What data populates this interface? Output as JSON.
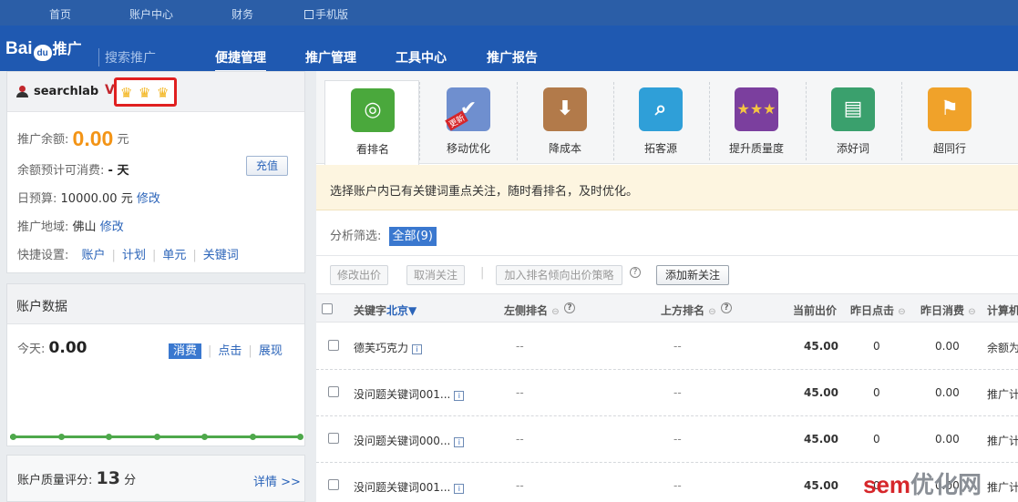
{
  "topnav": {
    "home": "首页",
    "account_center": "账户中心",
    "finance": "财务",
    "mobile": "手机版"
  },
  "header": {
    "logo": "Bai",
    "logo_paw": "du",
    "logo_tail": "推广",
    "sub": "搜索推广",
    "nav": [
      "便捷管理",
      "推广管理",
      "工具中心",
      "推广报告"
    ],
    "active_nav": "便捷管理"
  },
  "account": {
    "username": "searchlab",
    "v_mark": "V",
    "balance_label": "推广余额:",
    "balance_value": "0.00",
    "balance_unit": "元",
    "days_label": "余额预计可消费:",
    "days_value": "- 天",
    "recharge": "充值",
    "budget_label": "日预算:",
    "budget_value": "10000.00 元",
    "budget_edit": "修改",
    "region_label": "推广地域:",
    "region_value": "佛山",
    "region_edit": "修改",
    "quick_label": "快捷设置:",
    "quick": [
      "账户",
      "计划",
      "单元",
      "关键词"
    ]
  },
  "data": {
    "title": "账户数据",
    "today_label": "今天:",
    "today_value": "0.00",
    "tabs": [
      "消费",
      "点击",
      "展现"
    ]
  },
  "quality": {
    "label": "账户质量评分:",
    "score": "13",
    "unit": "分",
    "detail": "详情 >>"
  },
  "tools": [
    {
      "label": "看排名",
      "icon": "target-icon",
      "color": "#4aa83c"
    },
    {
      "label": "移动优化",
      "icon": "mobile-check-icon",
      "color": "#6f8fcf"
    },
    {
      "label": "降成本",
      "icon": "piggy-bank-icon",
      "color": "#b27a4a"
    },
    {
      "label": "拓客源",
      "icon": "magnifier-user-icon",
      "color": "#2f9fd8"
    },
    {
      "label": "提升质量度",
      "icon": "stars-icon",
      "color": "#7b3f9e"
    },
    {
      "label": "添好词",
      "icon": "word-board-icon",
      "color": "#3aa06d"
    },
    {
      "label": "超同行",
      "icon": "runner-icon",
      "color": "#f0a22a"
    }
  ],
  "tool_badge": "更新",
  "tip": "选择账户内已有关键词重点关注，随时看排名，及时优化。",
  "filter": {
    "label": "分析筛选:",
    "all": "全部(9)"
  },
  "buttons": {
    "modify_bid": "修改出价",
    "unfollow": "取消关注",
    "add_strategy": "加入排名倾向出价策略",
    "add_follow": "添加新关注"
  },
  "table": {
    "headers": {
      "keyword": "关键字",
      "region": "北京▼",
      "left_rank": "左侧排名",
      "top_rank": "上方排名",
      "bid": "当前出价",
      "y_click": "昨日点击",
      "y_cost": "昨日消费",
      "calc": "计算机"
    },
    "rows": [
      {
        "keyword": "德芙巧克力",
        "left": "--",
        "top": "--",
        "bid": "45.00",
        "click": "0",
        "cost": "0.00",
        "calc": "余额为"
      },
      {
        "keyword": "没问题关键词001...",
        "left": "--",
        "top": "--",
        "bid": "45.00",
        "click": "0",
        "cost": "0.00",
        "calc": "推广计"
      },
      {
        "keyword": "没问题关键词000...",
        "left": "--",
        "top": "--",
        "bid": "45.00",
        "click": "0",
        "cost": "0.00",
        "calc": "推广计"
      },
      {
        "keyword": "没问题关键词001...",
        "left": "--",
        "top": "--",
        "bid": "45.00",
        "click": "0",
        "cost": "0.00",
        "calc": "推广计"
      }
    ]
  },
  "watermark": {
    "a": "sem",
    "b": "优化网"
  }
}
